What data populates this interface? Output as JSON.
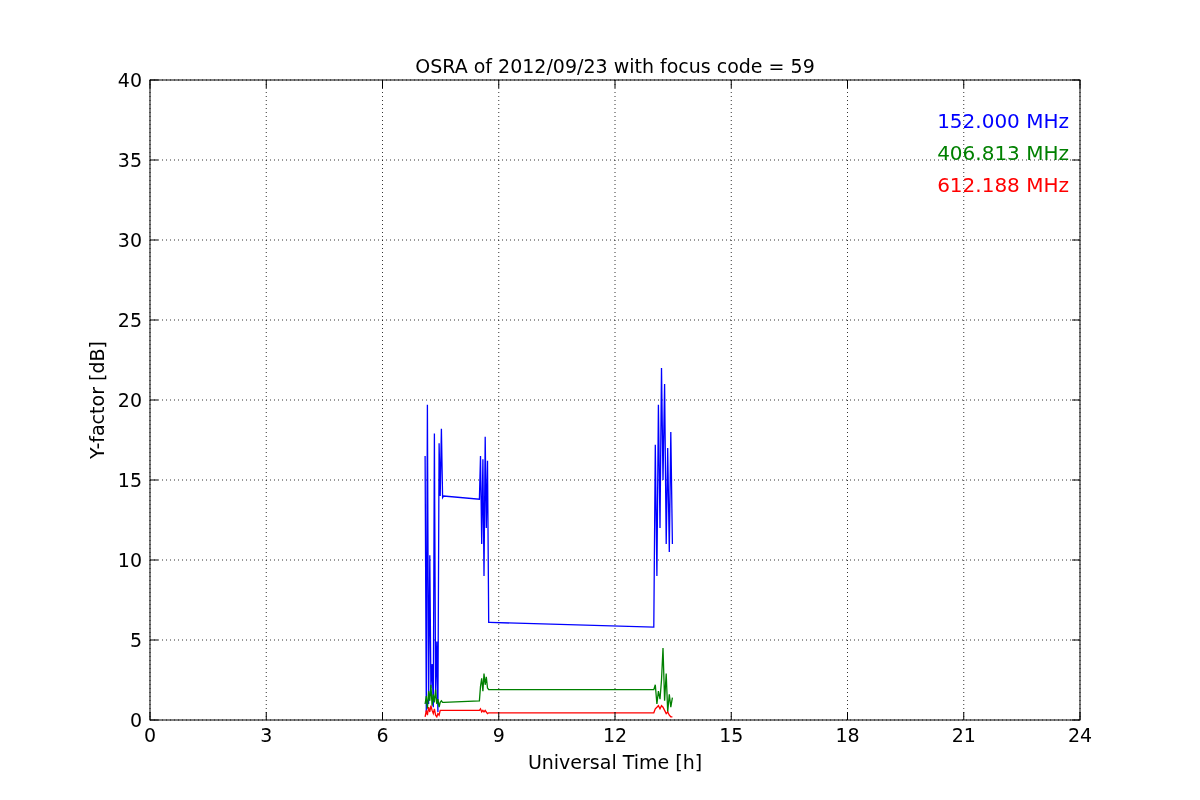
{
  "chart_data": {
    "type": "line",
    "title": "OSRA of 2012/09/23 with focus code = 59",
    "xlabel": "Universal Time [h]",
    "ylabel": "Y-factor [dB]",
    "x": [
      7.1,
      7.13,
      7.16,
      7.19,
      7.22,
      7.25,
      7.28,
      7.31,
      7.34,
      7.37,
      7.4,
      7.43,
      7.46,
      7.49,
      7.52,
      7.55,
      7.58,
      8.5,
      8.53,
      8.56,
      8.59,
      8.62,
      8.65,
      8.68,
      8.71,
      8.74,
      8.77,
      13.0,
      13.04,
      13.08,
      13.12,
      13.16,
      13.2,
      13.24,
      13.28,
      13.32,
      13.36,
      13.4,
      13.44,
      13.48
    ],
    "series": [
      {
        "name": "152.000 MHz",
        "color": "#0000ff",
        "values": [
          16.5,
          0.5,
          19.7,
          1.0,
          10.3,
          2.0,
          3.5,
          0.8,
          17.9,
          1.5,
          4.9,
          0.5,
          17.3,
          14.0,
          18.2,
          13.9,
          14.0,
          13.8,
          16.5,
          11.0,
          16.3,
          9.0,
          17.7,
          12.0,
          16.2,
          6.1,
          6.1,
          5.8,
          17.2,
          9.0,
          19.7,
          12.0,
          22.0,
          15.0,
          21.0,
          11.0,
          17.0,
          10.5,
          18.0,
          11.0
        ]
      },
      {
        "name": "406.813 MHz",
        "color": "#008000",
        "values": [
          1.0,
          1.5,
          0.7,
          1.8,
          1.2,
          2.2,
          0.9,
          1.6,
          1.1,
          1.9,
          1.0,
          1.3,
          0.8,
          1.1,
          1.2,
          1.1,
          1.1,
          1.2,
          2.1,
          2.6,
          1.8,
          2.9,
          2.2,
          2.7,
          2.0,
          1.9,
          1.9,
          1.9,
          2.2,
          1.0,
          1.8,
          1.3,
          2.5,
          4.5,
          1.2,
          2.9,
          0.5,
          1.6,
          0.8,
          1.4
        ]
      },
      {
        "name": "612.188 MHz",
        "color": "#ff0000",
        "values": [
          0.2,
          0.6,
          0.3,
          0.8,
          0.5,
          0.9,
          0.6,
          0.4,
          0.7,
          0.3,
          0.2,
          0.4,
          0.3,
          0.6,
          0.6,
          0.6,
          0.6,
          0.6,
          0.7,
          0.5,
          0.6,
          0.5,
          0.6,
          0.5,
          0.4,
          0.45,
          0.45,
          0.45,
          0.7,
          0.8,
          0.9,
          0.7,
          0.9,
          0.8,
          0.6,
          0.4,
          0.5,
          0.3,
          0.2,
          0.2
        ]
      }
    ],
    "grid": true,
    "xlim": [
      0,
      24
    ],
    "ylim": [
      0,
      40
    ],
    "xticks": [
      0,
      3,
      6,
      9,
      12,
      15,
      18,
      21,
      24
    ],
    "yticks": [
      0,
      5,
      10,
      15,
      20,
      25,
      30,
      35,
      40
    ]
  }
}
